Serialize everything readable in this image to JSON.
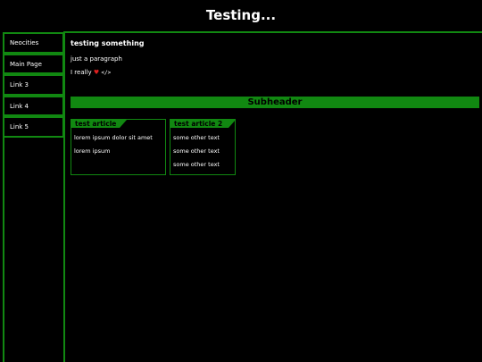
{
  "site": {
    "title": "Testing..."
  },
  "sidebar": {
    "items": [
      {
        "label": "Neocities"
      },
      {
        "label": "Main Page"
      },
      {
        "label": "Link 3"
      },
      {
        "label": "Link 4"
      },
      {
        "label": "Link 5"
      }
    ]
  },
  "main": {
    "heading": "testing something",
    "paragraph": "just a paragraph",
    "love_line_prefix": "I really",
    "heart_glyph": "♥",
    "code_glyph": "</>",
    "subheader": "Subheader"
  },
  "articles": [
    {
      "title": "test article",
      "lines": [
        "lorem ipsum dolor sit amet",
        "lorem ipsum"
      ]
    },
    {
      "title": "test article 2",
      "lines": [
        "some other text",
        "some other text",
        "some other text"
      ]
    }
  ],
  "colors": {
    "accent": "#118811",
    "background": "#000000",
    "text": "#ffffff",
    "heart": "#e02020"
  }
}
